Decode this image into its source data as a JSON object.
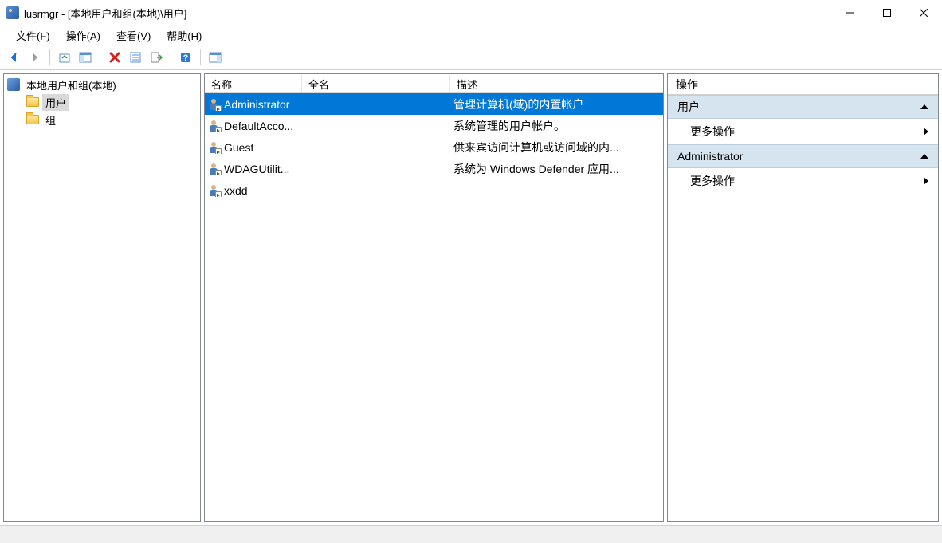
{
  "window": {
    "title": "lusrmgr - [本地用户和组(本地)\\用户]"
  },
  "menu": {
    "file": "文件(F)",
    "action": "操作(A)",
    "view": "查看(V)",
    "help": "帮助(H)"
  },
  "tree": {
    "root": "本地用户和组(本地)",
    "users": "用户",
    "groups": "组"
  },
  "columns": {
    "name": "名称",
    "fullname": "全名",
    "description": "描述"
  },
  "users": [
    {
      "name": "Administrator",
      "fullname": "",
      "description": "管理计算机(域)的内置帐户",
      "selected": true
    },
    {
      "name": "DefaultAcco...",
      "fullname": "",
      "description": "系统管理的用户帐户。",
      "selected": false
    },
    {
      "name": "Guest",
      "fullname": "",
      "description": "供来宾访问计算机或访问域的内...",
      "selected": false
    },
    {
      "name": "WDAGUtilit...",
      "fullname": "",
      "description": "系统为 Windows Defender 应用...",
      "selected": false
    },
    {
      "name": "xxdd",
      "fullname": "",
      "description": "",
      "selected": false
    }
  ],
  "actions": {
    "header": "操作",
    "group1": {
      "title": "用户",
      "more": "更多操作"
    },
    "group2": {
      "title": "Administrator",
      "more": "更多操作"
    }
  }
}
